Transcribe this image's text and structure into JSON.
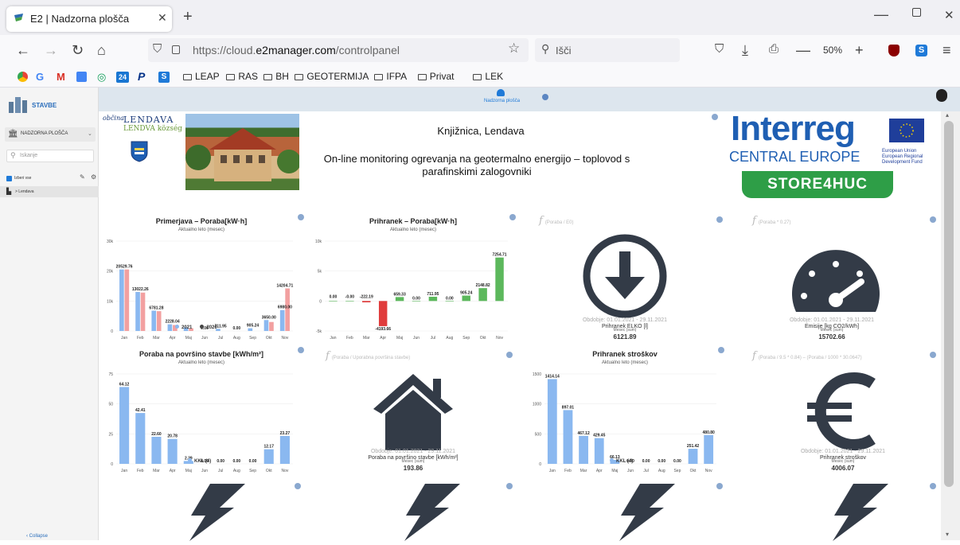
{
  "browser": {
    "tab_title": "E2 | Nadzorna plošča",
    "url_prefix": "https://cloud.",
    "url_domain": "e2manager.com",
    "url_path": "/controlpanel",
    "search_placeholder": "Išči",
    "zoom": "50%",
    "bookmark_24": "24",
    "bookmarks": [
      "LEAP",
      "RAS",
      "BH",
      "GEOTERMIJA",
      "IFPA",
      "Privat",
      "LEK"
    ]
  },
  "sidebar": {
    "app_name": "STAVBE",
    "dashboard_select": "NADZORNA PLOŠČA",
    "search_placeholder": "Iskanje",
    "select_all": "Izberi vse",
    "tree_item": "> Lendava",
    "collapse": "‹ Collapse"
  },
  "topstrip": {
    "tab_label": "Nadzorna plošča"
  },
  "header": {
    "municipality_prefix": "občina",
    "municipality_name": "LENDAVA",
    "municipality_sub": "LENDVA község",
    "building": "Knjižnica, Lendava",
    "subtitle": "On-line monitoring ogrevanja na geotermalno energijo – toplovod s parafinskimi zalogovniki",
    "interreg_line1": "Interreg",
    "interreg_line2": "CENTRAL EUROPE",
    "eu_text": "European Union European Regional Development Fund",
    "project_badge": "STORE4HUC"
  },
  "months": [
    "Jan",
    "Feb",
    "Mar",
    "Apr",
    "Maj",
    "Jun",
    "Jul",
    "Aug",
    "Sep",
    "Okt",
    "Nov"
  ],
  "colors": {
    "blue": "#8ab8f0",
    "pink": "#f2a0a0",
    "green": "#5cb85c",
    "red": "#e03b3b",
    "dark": "#333b47"
  },
  "chart_data": [
    {
      "type": "bar",
      "title": "Primerjava – Poraba[kW·h]",
      "subtitle": "Aktualno leto (mesec)",
      "y_ticks": [
        "30k",
        "20k",
        "10k",
        "0"
      ],
      "ylim": [
        0,
        30000
      ],
      "series": [
        {
          "name": "2021",
          "values": [
            20529.76,
            13022.26,
            6781.28,
            2228.04,
            1200,
            0.0,
            711.95,
            0.0,
            905.24,
            3650.0,
            6980.0
          ]
        },
        {
          "name": "2020",
          "values": [
            20529.76,
            12800,
            6600,
            2000,
            900,
            0.0,
            0.0,
            0.0,
            0.0,
            3000,
            14204.71
          ]
        }
      ],
      "labels": [
        "20529.76",
        "13022.26",
        "6781.28",
        "2228.04",
        "",
        "0.00",
        "711.95",
        "0.00",
        "905.24",
        "3650.00",
        "14204.71",
        "6980.00"
      ],
      "legend": [
        "2021",
        "2020"
      ]
    },
    {
      "type": "bar",
      "title": "Prihranek – Poraba[kW·h]",
      "subtitle": "Aktualno leto (mesec)",
      "y_ticks": [
        "10k",
        "5k",
        "0",
        "-5k"
      ],
      "ylim": [
        -5000,
        10000
      ],
      "values": [
        0.0,
        -0.0,
        -222.19,
        -4193.66,
        659.33,
        0.0,
        711.95,
        0.0,
        905.24,
        2148.82,
        7254.71
      ],
      "labels": [
        "0.00",
        "-0.00",
        "-222.19",
        "-4193.66",
        "659.33",
        "0.00",
        "711.95",
        "0.00",
        "905.24",
        "2148.82",
        "7254.71"
      ]
    },
    {
      "type": "bar",
      "title": "Poraba na površino stavbe [kWh/m²]",
      "subtitle": "Aktualno leto (mesec)",
      "y_ticks": [
        "75",
        "50",
        "25",
        "0"
      ],
      "ylim": [
        0,
        75
      ],
      "series": [
        {
          "name": "KKL (4)",
          "values": [
            64.12,
            42.41,
            22.6,
            20.78,
            2.39,
            0.0,
            0.0,
            0.0,
            0.0,
            12.17,
            23.27
          ]
        }
      ],
      "labels": [
        "64.12",
        "42.41",
        "22.60",
        "20.78",
        "2.39",
        "0.00",
        "0.00",
        "0.00",
        "0.00",
        "12.17",
        "23.27"
      ],
      "legend": [
        "KKL (4)"
      ]
    },
    {
      "type": "bar",
      "title": "Prihranek stroškov",
      "subtitle": "Aktualno leto (mesec)",
      "y_ticks": [
        "1500",
        "1000",
        "500",
        "0"
      ],
      "ylim": [
        0,
        1500
      ],
      "series": [
        {
          "name": "KKL (4)",
          "values": [
            1414.14,
            897.01,
            467.12,
            429.45,
            66.13,
            0.0,
            0.0,
            0.0,
            0.0,
            251.42,
            480.8
          ]
        }
      ],
      "labels": [
        "1414.14",
        "897.01",
        "467.12",
        "429.45",
        "66.13",
        "0.00",
        "0.00",
        "0.00",
        "0.00",
        "251.42",
        "480.80"
      ],
      "legend": [
        "KKL (4)"
      ]
    }
  ],
  "kpis": [
    {
      "formula": "(Poraba / E0)",
      "period": "Obdobje: 01.01.2021 - 29.11.2021",
      "label": "Prihranek ELKO [l]",
      "sub": "Mesec (sum)",
      "value": "6121.89"
    },
    {
      "formula": "(Poraba * 0.27)",
      "period": "Obdobje: 01.01.2021 - 29.11.2021",
      "label": "Emisije [kg CO2/kWh]",
      "sub": "Mesec (sum)",
      "value": "15702.66"
    },
    {
      "formula": "(Poraba / Uporabna površina stavbe)",
      "period": "Obdobje: 01.01.2021 - 29.11.2021",
      "label": "Poraba na površino stavbe [kWh/m²]",
      "sub": "Mesec (sum)",
      "value": "193.86"
    },
    {
      "formula": "(Poraba / 9.5 * 0.84) – (Poraba / 1000 * 30.0647)",
      "period": "Obdobje: 01.01.2021 - 29.11.2021",
      "label": "Prihranek stroškov",
      "sub": "Mesec (sum)",
      "value": "4006.07"
    }
  ]
}
